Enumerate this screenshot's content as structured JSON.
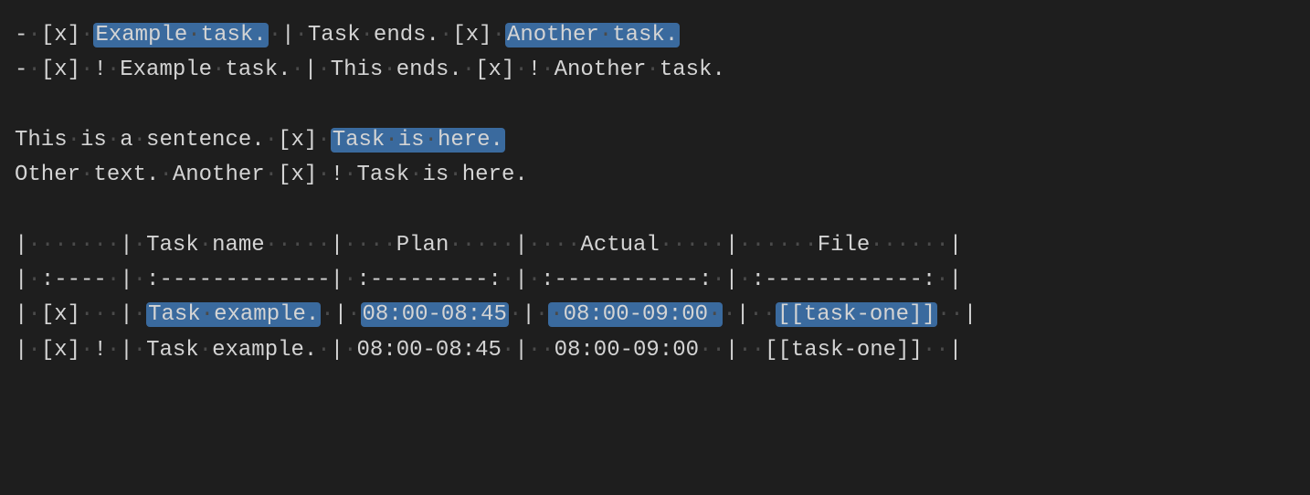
{
  "lines": {
    "l1": {
      "seg1": "-·[x]·",
      "seg2_hl": "Example·task.",
      "seg3": "·|·Task·ends.·[x]·",
      "seg4_hl": "Another·task."
    },
    "l2": {
      "seg1": "-·[x]·!·Example·task.·|·This·ends.·[x]·!·Another·task."
    },
    "l4": {
      "seg1": "This·is·a·sentence.·[x]·",
      "seg2_hl": "Task·is·here."
    },
    "l5": {
      "seg1": "Other·text.·Another·[x]·!·Task·is·here."
    },
    "l7": {
      "seg1": "|·······|·Task·name·····|····Plan·····|····Actual·····|······File······|"
    },
    "l8": {
      "seg1": "|·:----·|·:-------------|·:---------:·|·:-----------:·|·:------------:·|"
    },
    "l9": {
      "seg1": "|·[x]···|·",
      "seg2_hl": "Task·example.",
      "seg3": "·|·",
      "seg4_hl": "08:00-08:45",
      "seg5": "·|·",
      "seg6_hl": "·08:00-09:00·",
      "seg7": "·|··",
      "seg8_hl": "[[task-one]]",
      "seg9": "··|"
    },
    "l10": {
      "seg1": "|·[x]·!·|·Task·example.·|·08:00-08:45·|··08:00-09:00··|··[[task-one]]··|"
    }
  }
}
